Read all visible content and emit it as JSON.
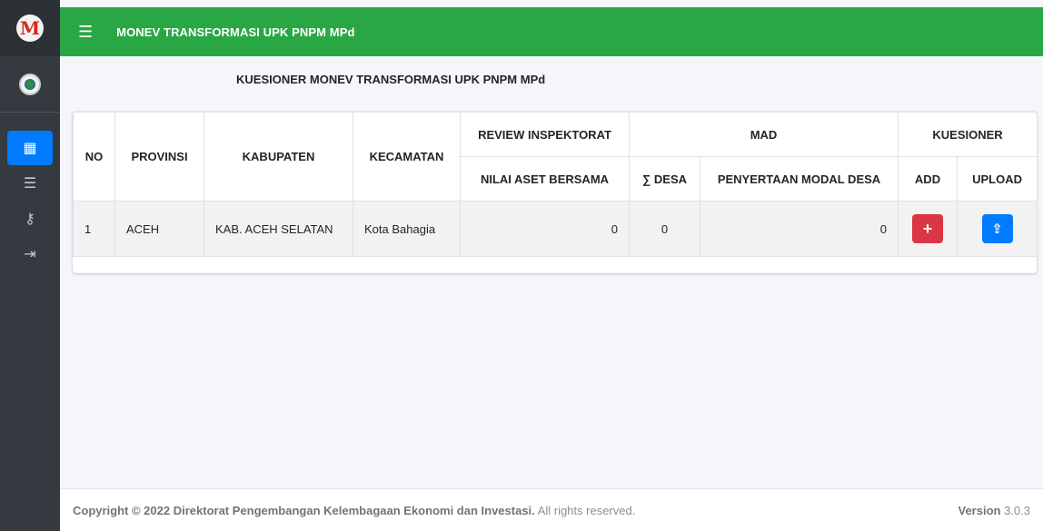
{
  "app": {
    "title": "MONEV TRANSFORMASI UPK PNPM MPd"
  },
  "page": {
    "title": "KUESIONER MONEV TRANSFORMASI UPK PNPM MPd"
  },
  "sidebar": {
    "items": [
      {
        "icon": "grid-icon",
        "glyph": "▦",
        "active": true
      },
      {
        "icon": "list-check-icon",
        "glyph": "☰",
        "active": false
      },
      {
        "icon": "key-icon",
        "glyph": "⚷",
        "active": false
      },
      {
        "icon": "sign-out-icon",
        "glyph": "⇥",
        "active": false
      }
    ]
  },
  "table": {
    "headers": {
      "no": "NO",
      "provinsi": "PROVINSI",
      "kabupaten": "KABUPATEN",
      "kecamatan": "KECAMATAN",
      "review_inspektorat": "REVIEW INSPEKTORAT",
      "mad": "MAD",
      "kuesioner": "KUESIONER",
      "nilai_aset": "NILAI ASET BERSAMA",
      "jumlah_desa": "∑ DESA",
      "penyertaan_modal": "PENYERTAAN MODAL DESA",
      "add": "ADD",
      "upload": "UPLOAD"
    },
    "rows": [
      {
        "no": "1",
        "provinsi": "ACEH",
        "kabupaten": "KAB. ACEH SELATAN",
        "kecamatan": "Kota Bahagia",
        "nilai_aset": "0",
        "jumlah_desa": "0",
        "penyertaan_modal": "0",
        "add_label": "+",
        "upload_label": "⇪"
      }
    ]
  },
  "footer": {
    "copyright_prefix": "Copyright © 2022 Direktorat Pengembangan Kelembagaan Ekonomi dan Investasi.",
    "copyright_suffix": " All rights reserved.",
    "version_label": "Version",
    "version_value": " 3.0.3"
  },
  "colors": {
    "topbar": "#2aa745",
    "sidebar": "#343a40",
    "active_nav": "#007bff",
    "add_button": "#dc3545",
    "upload_button": "#007bff"
  }
}
